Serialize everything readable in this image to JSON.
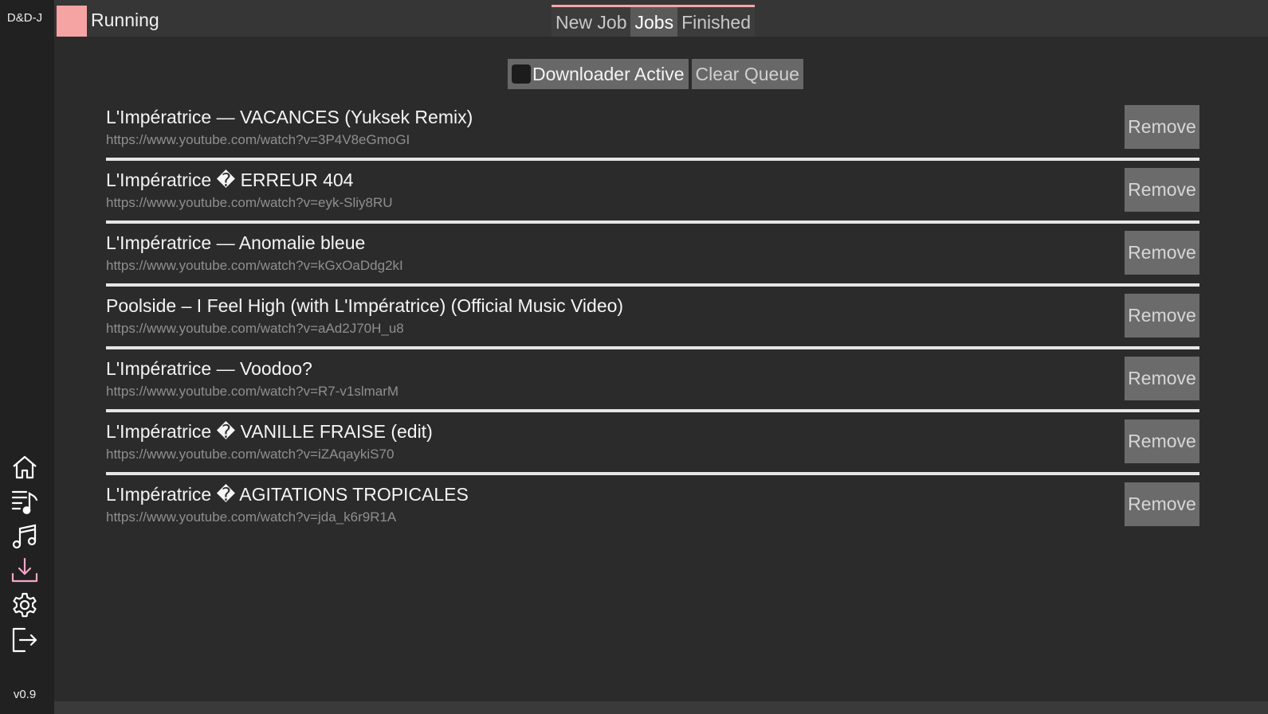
{
  "app": {
    "name": "D&D-J",
    "version": "v0.9"
  },
  "status": {
    "label": "Running",
    "color": "#f6a3a3"
  },
  "tabs": [
    {
      "label": "New Job",
      "active": false
    },
    {
      "label": "Jobs",
      "active": true
    },
    {
      "label": "Finished",
      "active": false
    }
  ],
  "controls": {
    "downloader_label": "Downloader Active",
    "downloader_checked": false,
    "clear_label": "Clear Queue"
  },
  "sidebar": {
    "items": [
      {
        "icon": "home-icon"
      },
      {
        "icon": "playlist-icon"
      },
      {
        "icon": "music-note-icon"
      },
      {
        "icon": "download-icon",
        "active": true
      },
      {
        "icon": "gear-icon"
      },
      {
        "icon": "logout-icon"
      }
    ],
    "accent_color": "#f6a6c8"
  },
  "jobs": [
    {
      "title": "L'Impératrice — VACANCES (Yuksek Remix)",
      "url": "https://www.youtube.com/watch?v=3P4V8eGmoGI",
      "remove_label": "Remove"
    },
    {
      "title": "L'Impératrice � ERREUR 404",
      "url": "https://www.youtube.com/watch?v=eyk-Sliy8RU",
      "remove_label": "Remove"
    },
    {
      "title": "L'Impératrice — Anomalie bleue",
      "url": "https://www.youtube.com/watch?v=kGxOaDdg2kI",
      "remove_label": "Remove"
    },
    {
      "title": "Poolside – I Feel High (with L'Impératrice) (Official Music Video)",
      "url": "https://www.youtube.com/watch?v=aAd2J70H_u8",
      "remove_label": "Remove"
    },
    {
      "title": "L'Impératrice — Voodoo?",
      "url": "https://www.youtube.com/watch?v=R7-v1slmarM",
      "remove_label": "Remove"
    },
    {
      "title": "L'Impératrice � VANILLE FRAISE  (edit)",
      "url": "https://www.youtube.com/watch?v=iZAqaykiS70",
      "remove_label": "Remove"
    },
    {
      "title": "L'Impératrice � AGITATIONS TROPICALES",
      "url": "https://www.youtube.com/watch?v=jda_k6r9R1A",
      "remove_label": "Remove"
    }
  ]
}
